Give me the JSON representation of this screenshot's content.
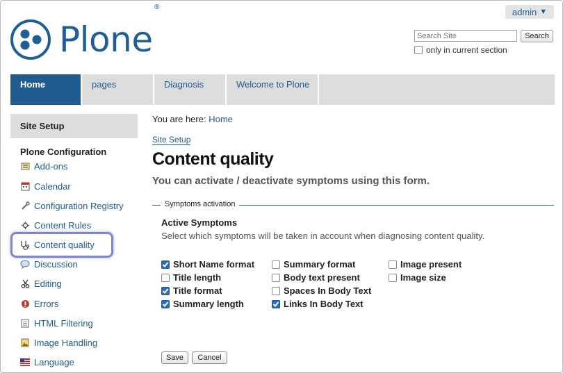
{
  "header": {
    "admin_label": "admin",
    "logo_text": "Plone",
    "logo_mark": "®",
    "search": {
      "placeholder": "Search Site",
      "button": "Search",
      "only_current": "only in current section"
    }
  },
  "nav": {
    "tabs": [
      {
        "label": "Home",
        "active": true
      },
      {
        "label": "pages",
        "active": false
      },
      {
        "label": "Diagnosis",
        "active": false
      },
      {
        "label": "Welcome to Plone",
        "active": false
      }
    ]
  },
  "sidebar": {
    "title": "Site Setup",
    "section": "Plone Configuration",
    "items": [
      {
        "label": "Add-ons",
        "icon": "addons-icon"
      },
      {
        "label": "Calendar",
        "icon": "calendar-icon"
      },
      {
        "label": "Configuration Registry",
        "icon": "wrench-icon"
      },
      {
        "label": "Content Rules",
        "icon": "content-rules-icon"
      },
      {
        "label": "Content quality",
        "icon": "stethoscope-icon"
      },
      {
        "label": "Discussion",
        "icon": "speech-bubble-icon"
      },
      {
        "label": "Editing",
        "icon": "scissors-icon"
      },
      {
        "label": "Errors",
        "icon": "error-icon"
      },
      {
        "label": "HTML Filtering",
        "icon": "document-icon"
      },
      {
        "label": "Image Handling",
        "icon": "image-icon"
      },
      {
        "label": "Language",
        "icon": "flag-icon"
      }
    ]
  },
  "main": {
    "breadcrumb_prefix": "You are here:",
    "breadcrumb_home": "Home",
    "site_setup_link": "Site Setup",
    "title": "Content quality",
    "description": "You can activate / deactivate symptoms using this form.",
    "legend": "Symptoms activation",
    "field_label": "Active Symptoms",
    "field_help": "Select which symptoms will be taken in account when diagnosing content quality.",
    "symptoms": [
      {
        "label": "Short Name format",
        "checked": true
      },
      {
        "label": "Title length",
        "checked": false
      },
      {
        "label": "Title format",
        "checked": true
      },
      {
        "label": "Summary length",
        "checked": true
      },
      {
        "label": "Summary format",
        "checked": false
      },
      {
        "label": "Body text present",
        "checked": false
      },
      {
        "label": "Spaces In Body Text",
        "checked": false
      },
      {
        "label": "Links In Body Text",
        "checked": true
      },
      {
        "label": "Image present",
        "checked": false
      },
      {
        "label": "Image size",
        "checked": false
      }
    ],
    "save_label": "Save",
    "cancel_label": "Cancel"
  }
}
